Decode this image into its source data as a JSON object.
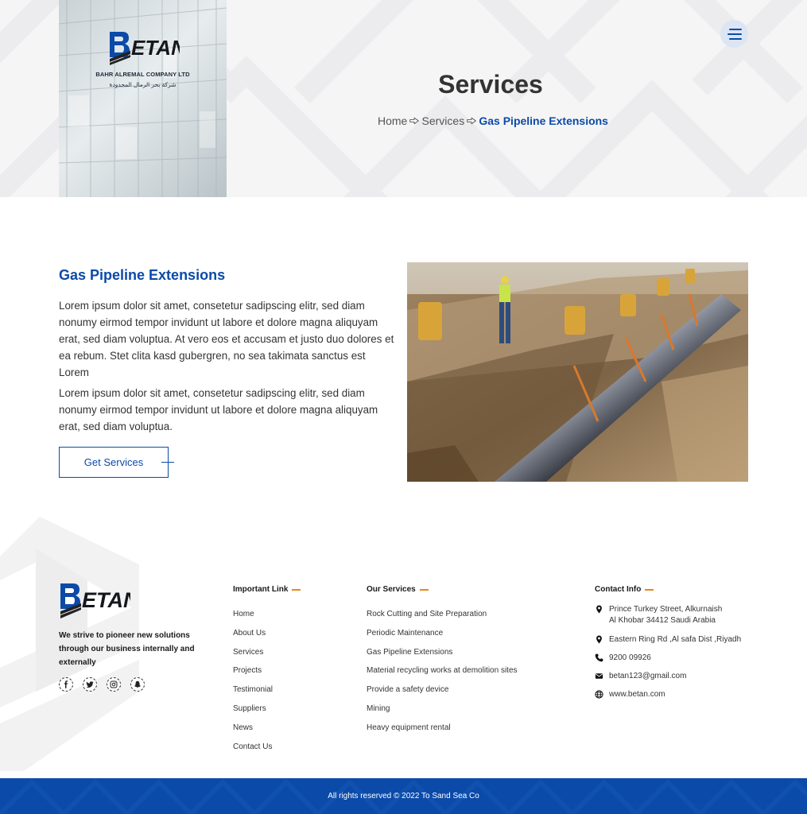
{
  "brand": {
    "logo_word": "ETAN",
    "logo_letter": "B",
    "company_name": "BAHR ALREMAL COMPANY LTD",
    "company_name_arabic": "شركة بحر الرمال المحدودة"
  },
  "hero": {
    "title": "Services",
    "breadcrumb": [
      "Home",
      "Services",
      "Gas Pipeline Extensions"
    ]
  },
  "content": {
    "title": "Gas Pipeline Extensions",
    "paragraph_1": "Lorem ipsum dolor sit amet, consetetur sadipscing elitr, sed diam nonumy eirmod tempor invidunt ut labore et dolore magna aliquyam erat, sed diam voluptua. At vero eos et accusam et justo duo dolores et ea rebum. Stet clita kasd gubergren, no sea takimata sanctus est Lorem",
    "paragraph_2": "Lorem ipsum dolor sit amet, consetetur sadipscing elitr, sed diam nonumy eirmod tempor invidunt ut labore et dolore magna aliquyam erat, sed diam voluptua.",
    "button_label": "Get Services"
  },
  "footer": {
    "tagline": "We strive to pioneer new solutions through our business internally and externally",
    "socials": [
      "facebook-icon",
      "twitter-icon",
      "instagram-icon",
      "snapchat-icon"
    ],
    "important_links_title": "Important Link",
    "important_links": [
      "Home",
      "About Us",
      "Services",
      "Projects",
      "Testimonial",
      "Suppliers",
      "News",
      "Contact Us"
    ],
    "services_title": "Our Services",
    "services": [
      "Rock Cutting and Site Preparation",
      "Periodic Maintenance",
      "Gas Pipeline Extensions",
      "Material recycling works at demolition sites",
      "Provide a safety device",
      "Mining",
      "Heavy equipment rental"
    ],
    "contact_title": "Contact Info",
    "contact": {
      "address_1_line_1": "Prince Turkey Street, Alkurnaish",
      "address_1_line_2": "Al Khobar 34412  Saudi Arabia",
      "address_2": "Eastern Ring Rd ,Al safa Dist ,Riyadh",
      "phone": "9200 09926",
      "email": "betan123@gmail.com",
      "website": "www.betan.com"
    },
    "copyright": "All rights reserved © 2022 To Sand Sea Co"
  },
  "colors": {
    "brand_blue": "#0b4aa8",
    "accent_orange": "#e8871e"
  }
}
